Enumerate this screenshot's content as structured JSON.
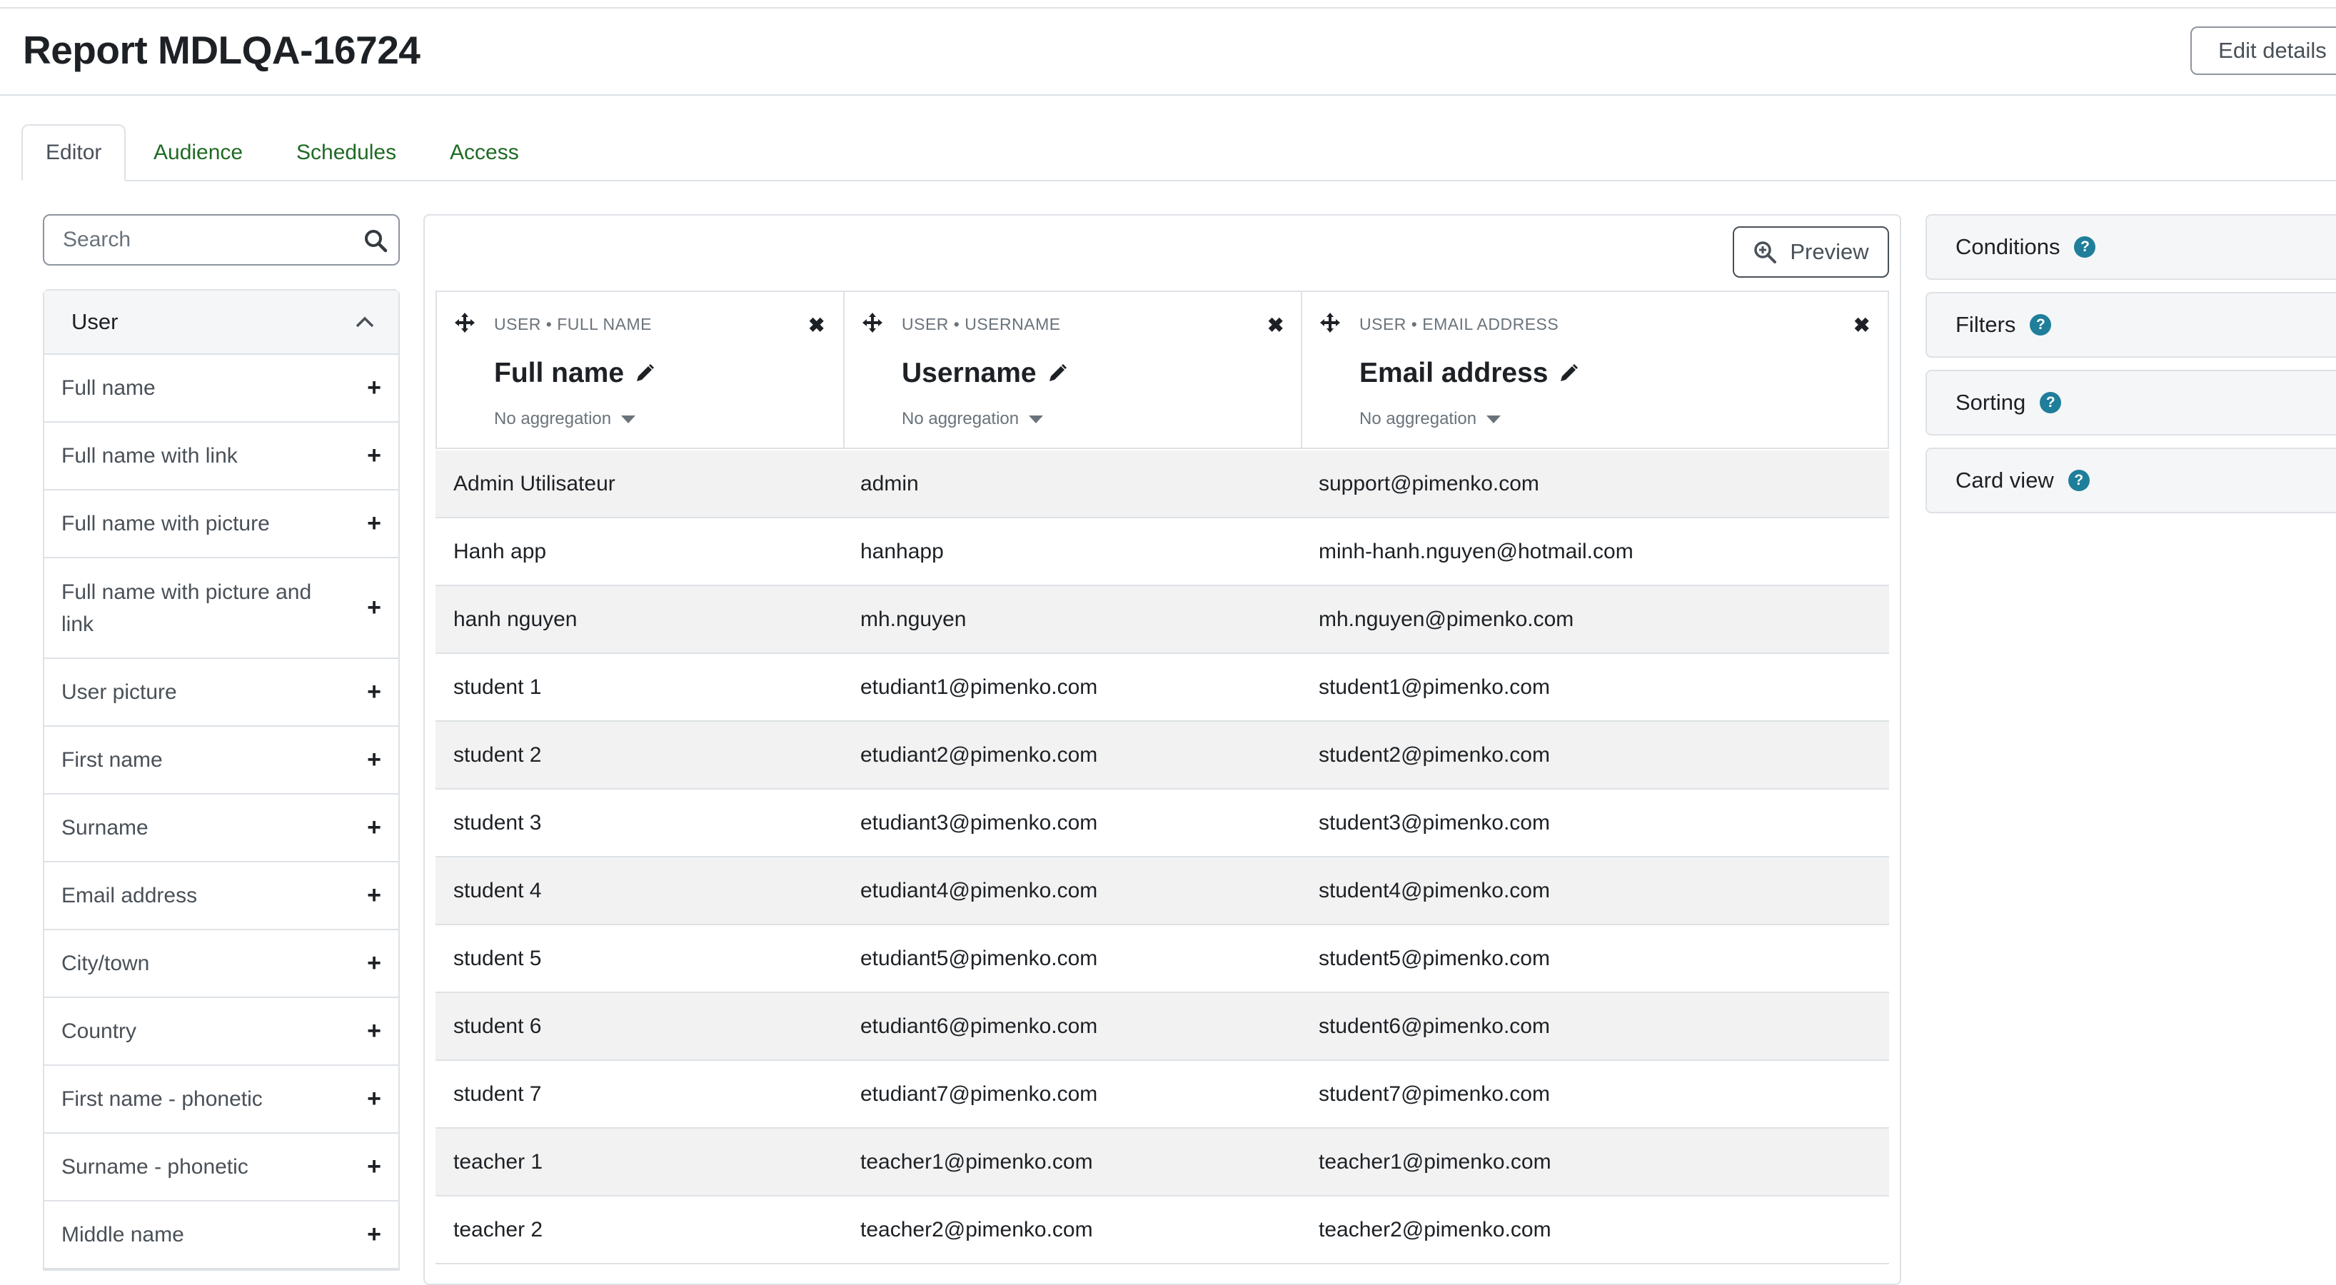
{
  "page": {
    "title": "Report MDLQA-16724",
    "edit_label": "Edit details"
  },
  "tabs": [
    {
      "label": "Editor",
      "active": true
    },
    {
      "label": "Audience"
    },
    {
      "label": "Schedules"
    },
    {
      "label": "Access"
    }
  ],
  "sidebar": {
    "search_placeholder": "Search",
    "group": "User",
    "items": [
      {
        "label": "Full name"
      },
      {
        "label": "Full name with link"
      },
      {
        "label": "Full name with picture"
      },
      {
        "label": "Full name with picture and link"
      },
      {
        "label": "User picture"
      },
      {
        "label": "First name"
      },
      {
        "label": "Surname"
      },
      {
        "label": "Email address"
      },
      {
        "label": "City/town"
      },
      {
        "label": "Country"
      },
      {
        "label": "First name - phonetic"
      },
      {
        "label": "Surname - phonetic"
      },
      {
        "label": "Middle name"
      }
    ]
  },
  "main": {
    "preview_label": "Preview",
    "columns": [
      {
        "source": "USER • FULL NAME",
        "title": "Full name",
        "aggregation": "No aggregation"
      },
      {
        "source": "USER • USERNAME",
        "title": "Username",
        "aggregation": "No aggregation"
      },
      {
        "source": "USER • EMAIL ADDRESS",
        "title": "Email address",
        "aggregation": "No aggregation"
      }
    ],
    "rows": [
      [
        "Admin Utilisateur",
        "admin",
        "support@pimenko.com"
      ],
      [
        "Hanh app",
        "hanhapp",
        "minh-hanh.nguyen@hotmail.com"
      ],
      [
        "hanh nguyen",
        "mh.nguyen",
        "mh.nguyen@pimenko.com"
      ],
      [
        "student 1",
        "etudiant1@pimenko.com",
        "student1@pimenko.com"
      ],
      [
        "student 2",
        "etudiant2@pimenko.com",
        "student2@pimenko.com"
      ],
      [
        "student 3",
        "etudiant3@pimenko.com",
        "student3@pimenko.com"
      ],
      [
        "student 4",
        "etudiant4@pimenko.com",
        "student4@pimenko.com"
      ],
      [
        "student 5",
        "etudiant5@pimenko.com",
        "student5@pimenko.com"
      ],
      [
        "student 6",
        "etudiant6@pimenko.com",
        "student6@pimenko.com"
      ],
      [
        "student 7",
        "etudiant7@pimenko.com",
        "student7@pimenko.com"
      ],
      [
        "teacher 1",
        "teacher1@pimenko.com",
        "teacher1@pimenko.com"
      ],
      [
        "teacher 2",
        "teacher2@pimenko.com",
        "teacher2@pimenko.com"
      ]
    ]
  },
  "settings": [
    {
      "label": "Conditions"
    },
    {
      "label": "Filters"
    },
    {
      "label": "Sorting"
    },
    {
      "label": "Card view"
    }
  ],
  "colors": {
    "tab_link": "#1f6b24",
    "help_icon": "#1f7e9a",
    "border": "#dee2e6",
    "stripe": "#f2f2f2"
  }
}
